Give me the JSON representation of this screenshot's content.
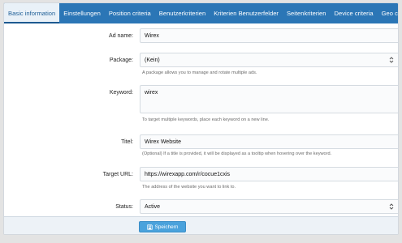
{
  "tabs": [
    {
      "label": "Basic information",
      "active": true
    },
    {
      "label": "Einstellungen",
      "active": false
    },
    {
      "label": "Position criteria",
      "active": false
    },
    {
      "label": "Benutzerkriterien",
      "active": false
    },
    {
      "label": "Kriterien Benutzerfelder",
      "active": false
    },
    {
      "label": "Seitenkriterien",
      "active": false
    },
    {
      "label": "Device criteria",
      "active": false
    },
    {
      "label": "Geo criteria",
      "active": false
    }
  ],
  "form": {
    "ad_name": {
      "label": "Ad name:",
      "value": "Wirex"
    },
    "package": {
      "label": "Package:",
      "value": "(Kein)",
      "hint": "A package allows you to manage and rotate multiple ads."
    },
    "keyword": {
      "label": "Keyword:",
      "value": "wirex",
      "hint": "To target multiple keywords, place each keyword on a new line."
    },
    "title": {
      "label": "Titel:",
      "value": "Wirex Website",
      "hint": "(Optional) If a title is provided, it will be displayed as a tooltip when hovering over the keyword."
    },
    "target_url": {
      "label": "Target URL:",
      "value": "https://wirexapp.com/r/cocue1cxis",
      "hint": "The address of the website you want to link to."
    },
    "status": {
      "label": "Status:",
      "value": "Active"
    }
  },
  "footer": {
    "save_label": "Speichern"
  },
  "icons": {
    "select": "chevron-updown-icon",
    "save": "floppy-disk-icon"
  },
  "colors": {
    "tabbar": "#2b76b6",
    "active_tab": "#e9f1f8",
    "save_button": "#4aa2dc"
  }
}
